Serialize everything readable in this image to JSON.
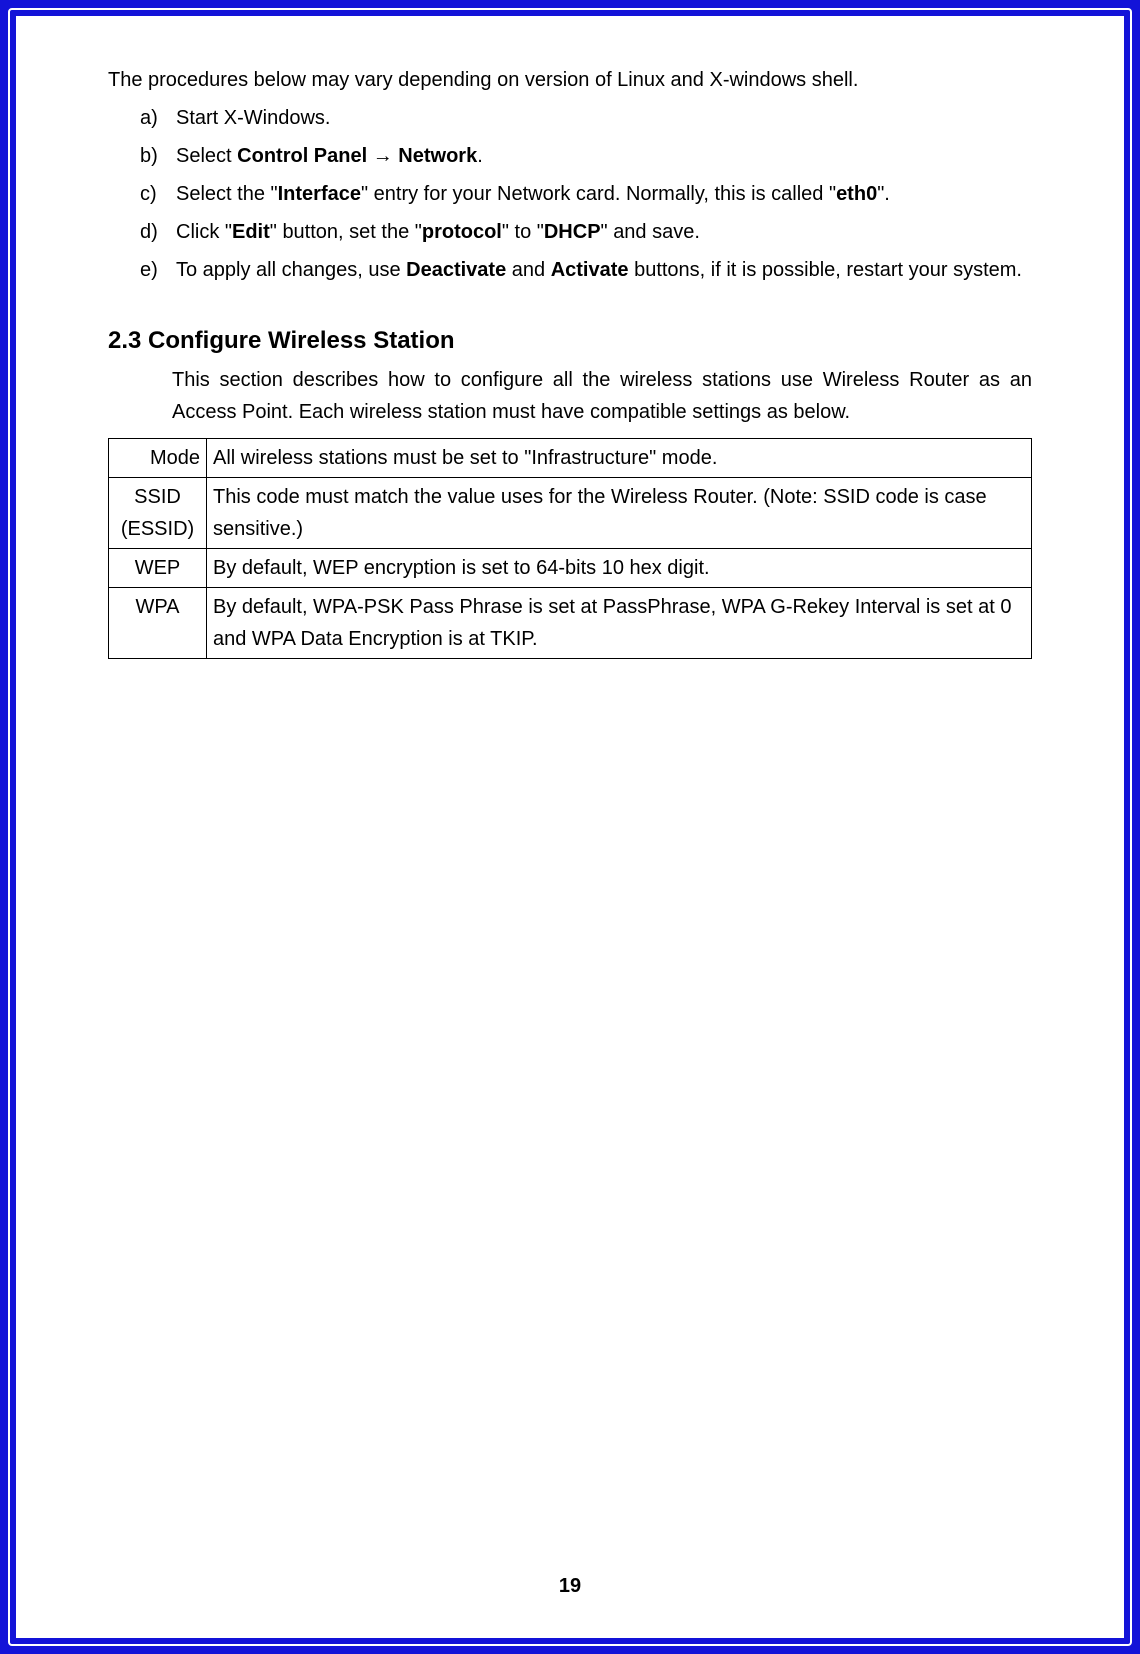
{
  "intro": "The procedures below may vary depending on version of Linux and X-windows shell.",
  "list": {
    "a": {
      "marker": "a)",
      "text": "Start X-Windows."
    },
    "b": {
      "marker": "b)",
      "pre": "Select ",
      "b1": "Control Panel ",
      "arrow": "→",
      "b2": " Network",
      "post": "."
    },
    "c": {
      "marker": "c)",
      "p1": "Select the \"",
      "b1": "Interface",
      "p2": "\" entry for your Network card.    Normally, this is called \"",
      "b2": "eth0",
      "p3": "\"."
    },
    "d": {
      "marker": "d)",
      "p1": "Click \"",
      "b1": "Edit",
      "p2": "\" button, set the \"",
      "b2": "protocol",
      "p3": "\" to \"",
      "b3": "DHCP",
      "p4": "\" and save."
    },
    "e": {
      "marker": "e)",
      "p1": "To apply all changes, use ",
      "b1": "Deactivate",
      "p2": " and ",
      "b2": "Activate",
      "p3": " buttons, if it is possible, restart your system."
    }
  },
  "section": {
    "heading": "2.3 Configure Wireless Station",
    "desc": "This section describes how to configure all the wireless stations use Wireless Router as an Access Point.    Each wireless station must have compatible settings as below."
  },
  "table": {
    "r1": {
      "k": "Mode",
      "v": "All wireless stations must be set to \"Infrastructure\" mode."
    },
    "r2": {
      "k1": "SSID",
      "k2": "(ESSID)",
      "v": "This code must match the value uses for the Wireless Router.    (Note: SSID code is case sensitive.)"
    },
    "r3": {
      "k": "WEP",
      "v": "By default, WEP encryption is set to 64-bits 10 hex digit."
    },
    "r4": {
      "k": "WPA",
      "v": "By default, WPA-PSK Pass Phrase is set at PassPhrase, WPA G-Rekey Interval is set at 0 and WPA Data Encryption is at TKIP."
    }
  },
  "page_number": "19"
}
